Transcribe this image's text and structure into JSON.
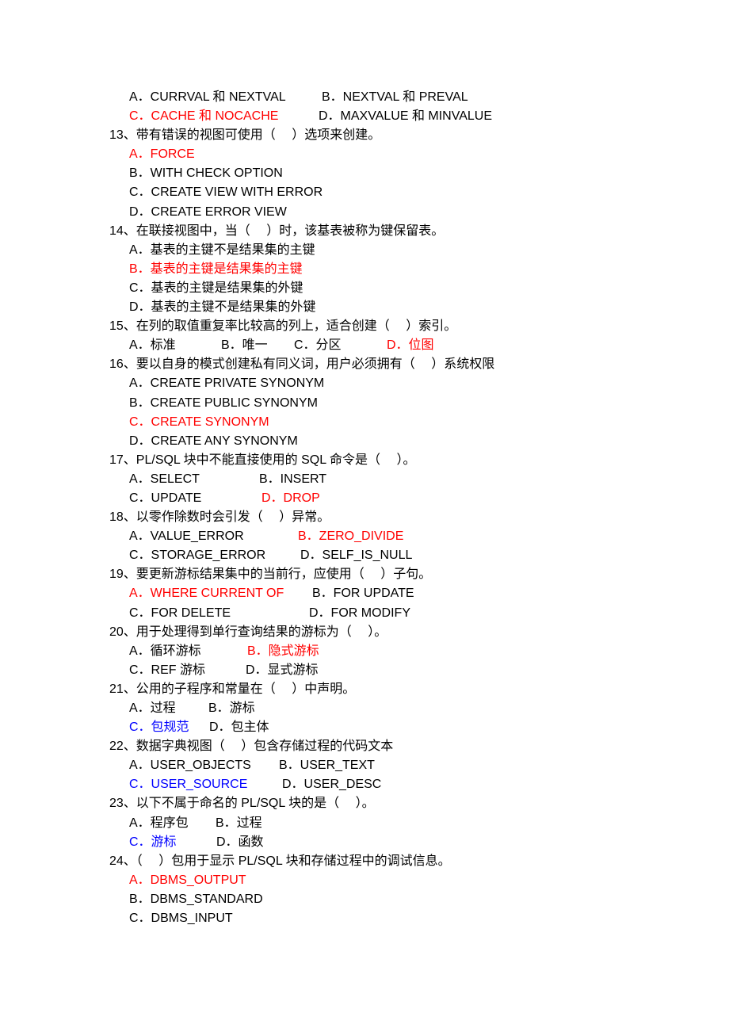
{
  "colors": {
    "text": "#000000",
    "answer_red": "#ff0000",
    "answer_blue": "#0000ff"
  },
  "q12_options": {
    "a": "A．CURRVAL 和 NEXTVAL",
    "b": "B．NEXTVAL 和 PREVAL",
    "c": "C．CACHE 和 NOCACHE",
    "d": "D．MAXVALUE 和 MINVALUE"
  },
  "q13": {
    "question": "13、带有错误的视图可使用（　 ）选项来创建。",
    "a": "A．FORCE",
    "b": "B．WITH CHECK OPTION",
    "c": "C．CREATE VIEW WITH ERROR",
    "d": "D．CREATE ERROR VIEW"
  },
  "q14": {
    "question": "14、在联接视图中，当（　 ）时，该基表被称为键保留表。",
    "a": "A．基表的主键不是结果集的主键",
    "b": "B．基表的主键是结果集的主键",
    "c": "C．基表的主键是结果集的外键",
    "d": "D．基表的主键不是结果集的外键"
  },
  "q15": {
    "question": "15、在列的取值重复率比较高的列上，适合创建（　 ）索引。",
    "a": "A．标准",
    "b": "B．唯一",
    "c": "C．分区",
    "d": "D．位图"
  },
  "q16": {
    "question": "16、要以自身的模式创建私有同义词，用户必须拥有（　 ）系统权限",
    "a": "A．CREATE PRIVATE SYNONYM",
    "b": "B．CREATE PUBLIC SYNONYM",
    "c": "C．CREATE SYNONYM",
    "d": "D．CREATE ANY SYNONYM"
  },
  "q17": {
    "question": "17、PL/SQL 块中不能直接使用的 SQL 命令是（　 ）。",
    "a": "A．SELECT",
    "b": "B．INSERT",
    "c": "C．UPDATE",
    "d": "D．DROP"
  },
  "q18": {
    "question": "18、以零作除数时会引发（　 ）异常。",
    "a": "A．VALUE_ERROR",
    "b": "B．ZERO_DIVIDE",
    "c": "C．STORAGE_ERROR",
    "d": "D．SELF_IS_NULL"
  },
  "q19": {
    "question": "19、要更新游标结果集中的当前行，应使用（　 ）子句。",
    "a": "A．WHERE CURRENT OF",
    "b": "B．FOR UPDATE",
    "c": "C．FOR DELETE",
    "d": "D．FOR MODIFY"
  },
  "q20": {
    "question": "20、用于处理得到单行查询结果的游标为（　 ）。",
    "a": "A．循环游标",
    "b": "B．隐式游标",
    "c": "C．REF 游标",
    "d": "D．显式游标"
  },
  "q21": {
    "question": "21、公用的子程序和常量在（　 ）中声明。",
    "a": "A．过程",
    "b": "B．游标",
    "c": "C．包规范",
    "d": "D．包主体"
  },
  "q22": {
    "question": "22、数据字典视图（　 ）包含存储过程的代码文本",
    "a": "A．USER_OBJECTS",
    "b": "B．USER_TEXT",
    "c": "C．USER_SOURCE",
    "d": "D．USER_DESC"
  },
  "q23": {
    "question": "23、以下不属于命名的 PL/SQL 块的是（　 ）。",
    "a": "A．程序包",
    "b": "B．过程",
    "c": "C．游标",
    "d": "D．函数"
  },
  "q24": {
    "question": "24、（　 ）包用于显示 PL/SQL 块和存储过程中的调试信息。",
    "a": "A．DBMS_OUTPUT",
    "b": "B．DBMS_STANDARD",
    "c": "C．DBMS_INPUT"
  }
}
